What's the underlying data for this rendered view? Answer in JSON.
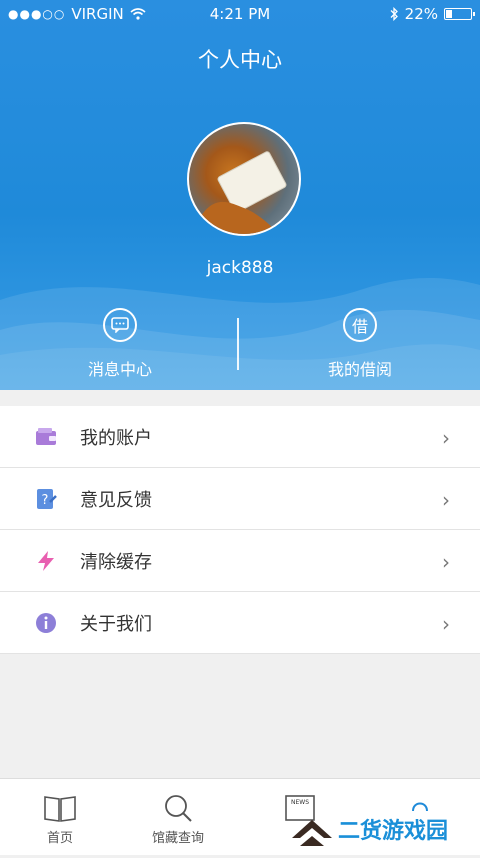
{
  "status_bar": {
    "carrier": "VIRGIN",
    "time": "4:21 PM",
    "battery": "22%",
    "battery_level": 0.22
  },
  "header": {
    "title": "个人中心",
    "username": "jack888"
  },
  "actions": [
    {
      "label": "消息中心",
      "icon": "message-icon"
    },
    {
      "label": "我的借阅",
      "icon": "borrow-icon",
      "glyph": "借"
    }
  ],
  "menu": [
    {
      "label": "我的账户",
      "icon": "wallet-icon",
      "color": "#a97bd9"
    },
    {
      "label": "意见反馈",
      "icon": "feedback-icon",
      "color": "#5c8fe0"
    },
    {
      "label": "清除缓存",
      "icon": "lightning-icon",
      "color": "#e85fb0"
    },
    {
      "label": "关于我们",
      "icon": "info-icon",
      "color": "#8d7fd8"
    }
  ],
  "tabs": [
    {
      "label": "首页",
      "icon": "book-icon"
    },
    {
      "label": "馆藏查询",
      "icon": "search-icon"
    },
    {
      "label": "",
      "icon": "news-icon",
      "icon_text": "NEWS"
    },
    {
      "label": "",
      "icon": "user-icon"
    }
  ],
  "watermark": {
    "text": "二货游戏园"
  },
  "colors": {
    "header_blue": "#1f8ad9",
    "background": "#f0f0f0"
  }
}
